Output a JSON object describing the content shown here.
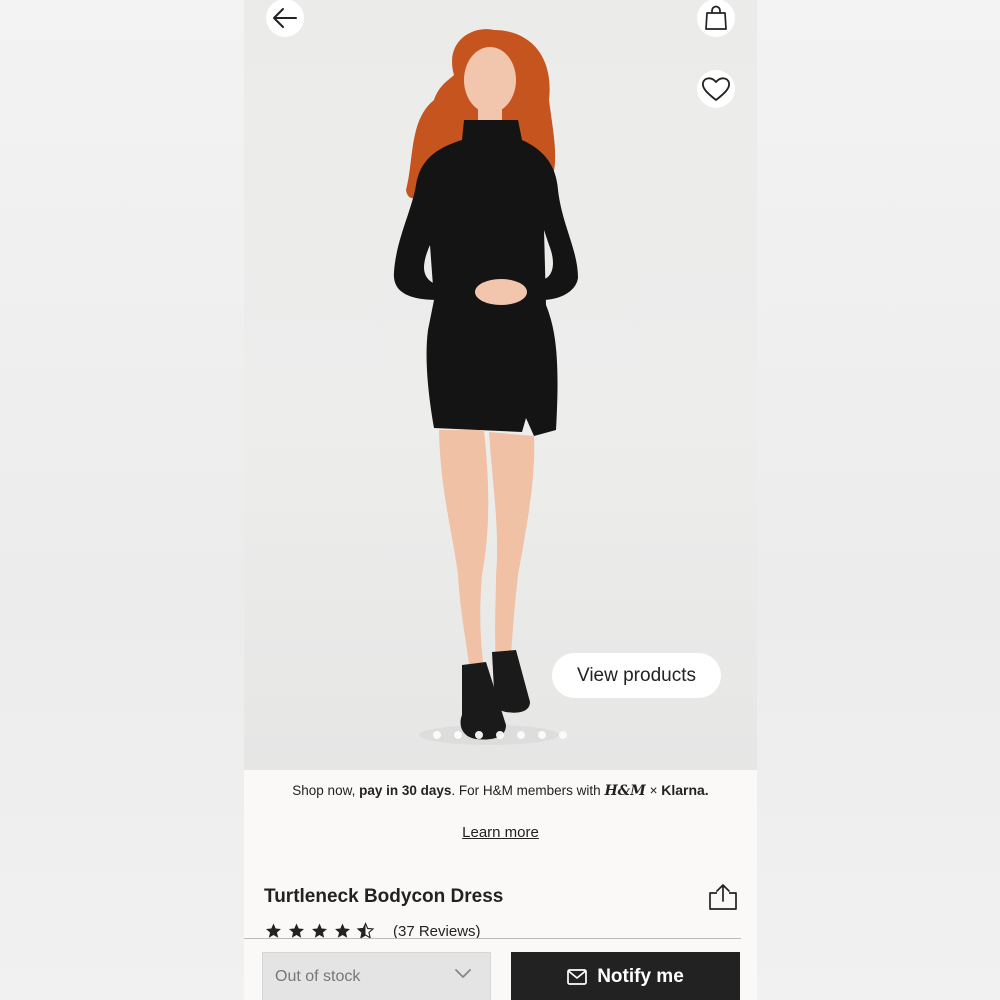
{
  "hero": {
    "view_products_label": "View products",
    "carousel_dots": 7,
    "carousel_active_index": 1
  },
  "promo": {
    "prefix": "Shop now, ",
    "highlight": "pay in 30 days",
    "suffix": ". For H&M members with ",
    "hm_logo": "H&M",
    "times": "×",
    "klarna_logo": "Klarna."
  },
  "learn_more_label": "Learn more",
  "product": {
    "title": "Turtleneck Bodycon Dress",
    "rating": 4.5,
    "reviews_label": "(37 Reviews)"
  },
  "actions": {
    "size_select_value": "Out of stock",
    "notify_label": "Notify me"
  },
  "icons": {
    "back": "arrow-left-icon",
    "bag": "shopping-bag-icon",
    "favorite": "heart-icon",
    "share": "share-icon",
    "notify": "envelope-icon",
    "select": "chevron-down-icon"
  }
}
